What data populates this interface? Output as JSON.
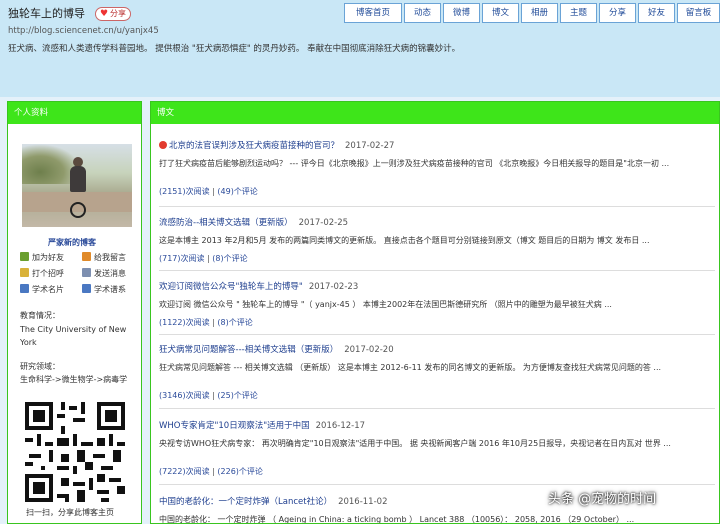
{
  "header": {
    "blog_title": "独轮车上的博导",
    "share_label": "分享",
    "url": "http://blog.sciencenet.cn/u/yanjx45",
    "description": "狂犬病、流感和人类遗传学科普园地。 提供根治 \"狂犬病恐惧症\" 的灵丹妙药。 奉献在中国彻底消除狂犬病的锦囊妙计。"
  },
  "nav": [
    "博客首页",
    "动态",
    "微博",
    "博文",
    "相册",
    "主题",
    "分享",
    "好友",
    "留言板"
  ],
  "left": {
    "head": "个人资料",
    "new_posts": "严家新的博客",
    "actions": [
      "加为好友",
      "给我留言",
      "打个招呼",
      "发送消息",
      "学术名片",
      "学术谱系"
    ],
    "edu_label": "教育情况：",
    "edu_value": "The City University of New York",
    "field_label": "研究领域：",
    "field_value": "生命科学->微生物学->病毒学",
    "qr_caption": "扫一扫，分享此博客主页"
  },
  "right": {
    "head": "博文",
    "posts": [
      {
        "title": "北京的法官误判涉及狂犬病疫苗接种的官司？",
        "date": "2017-02-27",
        "excerpt": "打了狂犬病疫苗后能够剧烈运动吗？ --- 评今日《北京晚报》上一则涉及狂犬病疫苗接种的官司 《北京晚报》今日相关报导的题目是\"北京一初 ...",
        "reads": "(2151)次阅读",
        "comments": "(49)个评论"
      },
      {
        "title": "流感防治--相关博文选辑（更新版）",
        "date": "2017-02-25",
        "excerpt": "这是本博主 2013 年2月和5月 发布的两篇同类博文的更新版。 直接点击各个题目可分别链接到原文（博文 题目后的日期为 博文 发布日 ...",
        "reads": "(717)次阅读",
        "comments": "(8)个评论"
      },
      {
        "title": "欢迎订阅微信公众号\"独轮车上的博导\"",
        "date": "2017-02-23",
        "excerpt": "欢迎订阅 微信公众号 \" 独轮车上的博导 \"（ yanjx-45 ） 本博主2002年在法国巴斯德研究所 （照片中的雕塑为最早被狂犬病 ...",
        "reads": "(1122)次阅读",
        "comments": "(8)个评论"
      },
      {
        "title": "狂犬病常见问题解答---相关博文选辑（更新版）",
        "date": "2017-02-20",
        "excerpt": "狂犬病常见问题解答 --- 相关博文选辑 （更新版） 这是本博主 2012-6-11 发布的同名博文的更新版。 为方便博友查找狂犬病常见问题的答 ...",
        "reads": "(3146)次阅读",
        "comments": "(25)个评论"
      },
      {
        "title": "WHO专家肯定\"10日观察法\"适用于中国",
        "date": "2016-12-17",
        "excerpt": "央视专访WHO狂犬病专家： 再次明确肯定\"10日观察法\"适用于中国。 据 央视新闻客户端 2016 年10月25日报导，央视记者在日内瓦对 世界 ...",
        "reads": "(7222)次阅读",
        "comments": "(226)个评论"
      },
      {
        "title": "中国的老龄化：一个定时炸弹（Lancet社论）",
        "date": "2016-11-02",
        "excerpt": "中国的老龄化： 一个定时炸弹 （ Ageing in China: a ticking bomb ） Lancet 388 （10056）： 2058, 2016 （29 October） ...",
        "reads": "",
        "comments": ""
      }
    ]
  },
  "watermark": "头条 @宠物的时间",
  "colors": {
    "header_bg": "#c9e7f6",
    "panel_head": "#3ee51a",
    "panel_border": "#39c51f",
    "link": "#1f3f8f"
  }
}
